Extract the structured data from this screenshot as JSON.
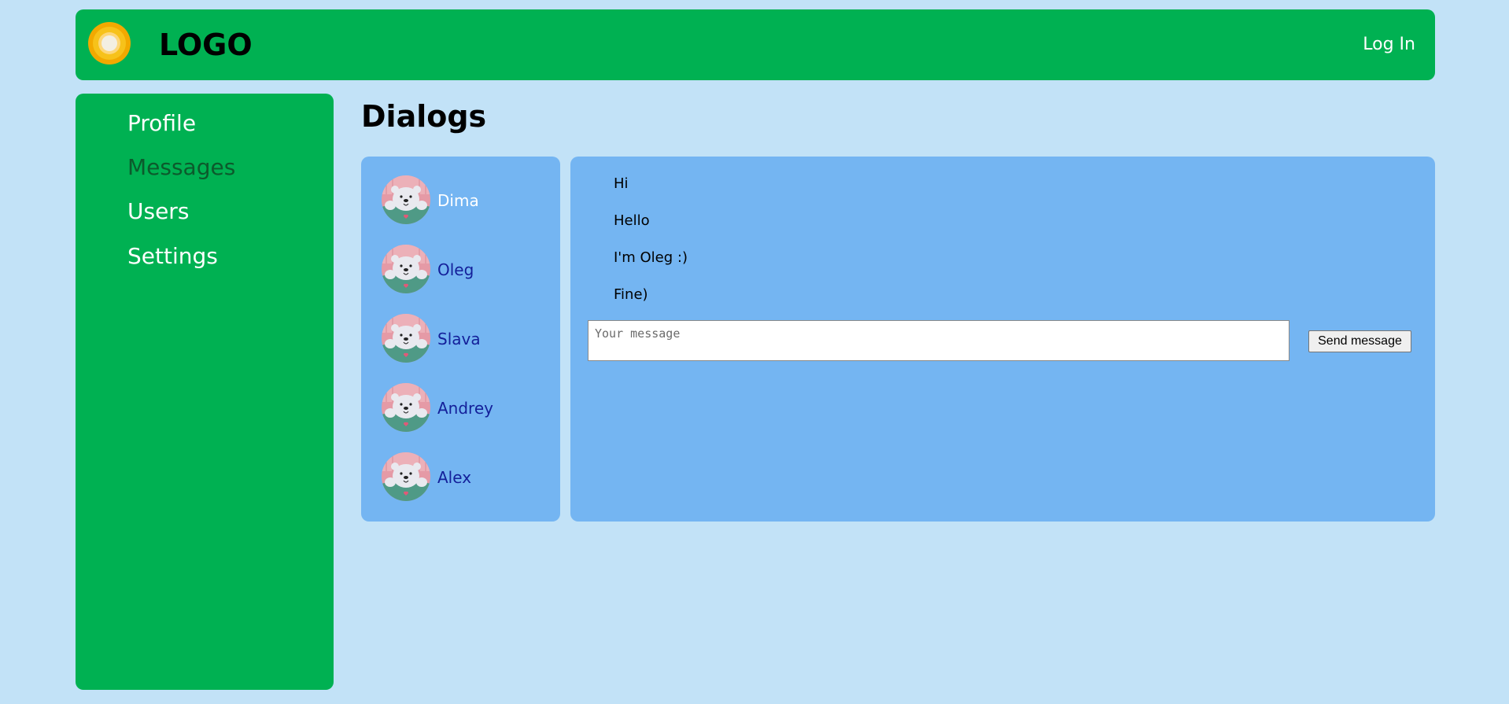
{
  "header": {
    "logo_icon": "orange-ring-logo-icon",
    "logo_text": "LOGO",
    "login_label": "Log In"
  },
  "sidebar": {
    "items": [
      {
        "label": "Profile",
        "active": false
      },
      {
        "label": "Messages",
        "active": true
      },
      {
        "label": "Users",
        "active": false
      },
      {
        "label": "Settings",
        "active": false
      }
    ]
  },
  "main": {
    "title": "Dialogs",
    "dialogs": [
      {
        "name": "Dima",
        "selected": true,
        "avatar": "bear-avatar-icon"
      },
      {
        "name": "Oleg",
        "selected": false,
        "avatar": "bear-avatar-icon"
      },
      {
        "name": "Slava",
        "selected": false,
        "avatar": "bear-avatar-icon"
      },
      {
        "name": "Andrey",
        "selected": false,
        "avatar": "bear-avatar-icon"
      },
      {
        "name": "Alex",
        "selected": false,
        "avatar": "bear-avatar-icon"
      }
    ],
    "messages": [
      {
        "text": "Hi"
      },
      {
        "text": "Hello"
      },
      {
        "text": "I'm Oleg :)"
      },
      {
        "text": "Fine)"
      }
    ],
    "input": {
      "value": "",
      "placeholder": "Your message"
    },
    "send_label": "Send message"
  },
  "colors": {
    "background": "#c2e2f7",
    "green": "#00b152",
    "panel_blue": "#74b5f2",
    "link_blue": "#14209a",
    "active_nav": "#0c5a2c"
  }
}
